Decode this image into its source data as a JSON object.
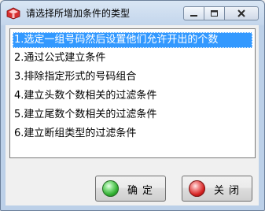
{
  "window": {
    "title": "请选择所增加条件的类型",
    "min_icon": "minimize-icon",
    "max_icon": "maximize-icon",
    "close_icon": "close-icon"
  },
  "list": {
    "items": [
      "1.选定一组号码然后设置他们允许开出的个数",
      "2.通过公式建立条件",
      "3.排除指定形式的号码组合",
      "4.建立头数个数相关的过滤条件",
      "5.建立尾数个数相关的过滤条件",
      "6.建立断组类型的过滤条件"
    ],
    "selected_index": 0
  },
  "buttons": {
    "ok_label": "确定",
    "cancel_label": "关闭",
    "ok_icon": "green-orb-icon",
    "cancel_icon": "red-orb-icon"
  },
  "colors": {
    "selection": "#3399ff",
    "frame": "#bcd0e8"
  }
}
